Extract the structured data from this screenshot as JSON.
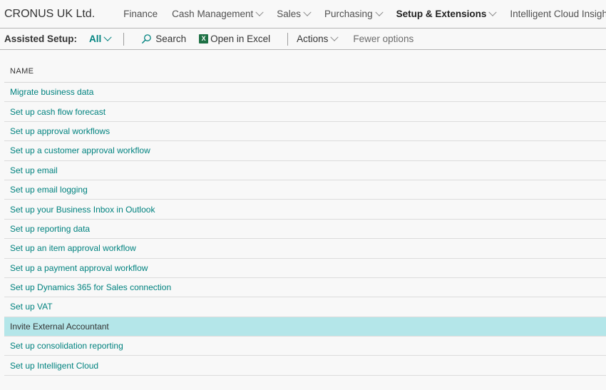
{
  "topnav": {
    "company": "CRONUS UK Ltd.",
    "items": [
      {
        "label": "Finance",
        "active": false
      },
      {
        "label": "Cash Management",
        "active": false
      },
      {
        "label": "Sales",
        "active": false
      },
      {
        "label": "Purchasing",
        "active": false
      },
      {
        "label": "Setup & Extensions",
        "active": true
      },
      {
        "label": "Intelligent Cloud Insights",
        "active": false
      }
    ]
  },
  "actionbar": {
    "page_caption": "Assisted Setup:",
    "filter": "All",
    "search_label": "Search",
    "excel_label": "Open in Excel",
    "actions_label": "Actions",
    "fewer_label": "Fewer options"
  },
  "list": {
    "column_header": "NAME",
    "selected_index": 12,
    "rows": [
      "Migrate business data",
      "Set up cash flow forecast",
      "Set up approval workflows",
      "Set up a customer approval workflow",
      "Set up email",
      "Set up email logging",
      "Set up your Business Inbox in Outlook",
      "Set up reporting data",
      "Set up an item approval workflow",
      "Set up a payment approval workflow",
      "Set up Dynamics 365 for Sales connection",
      "Set up VAT",
      "Invite External Accountant",
      "Set up consolidation reporting",
      "Set up Intelligent Cloud"
    ]
  },
  "colors": {
    "accent": "#00827f",
    "selected_row": "#b4e6e9"
  }
}
